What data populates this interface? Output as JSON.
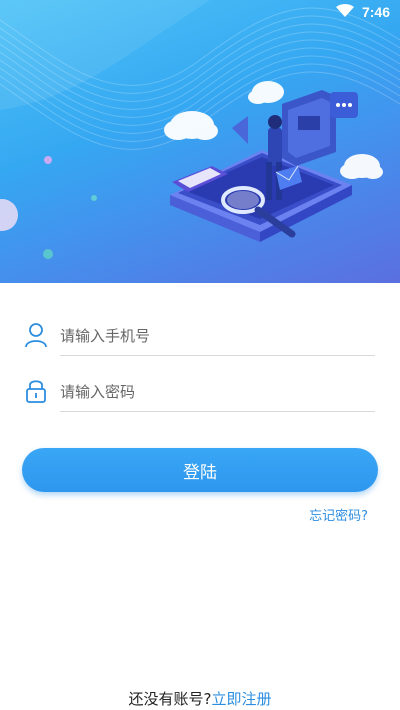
{
  "status_bar": {
    "time": "7:46",
    "wifi_icon": "wifi-icon"
  },
  "login_form": {
    "phone_placeholder": "请输入手机号",
    "phone_value": "",
    "password_placeholder": "请输入密码",
    "password_value": "",
    "login_label": "登陆",
    "forgot_label": "忘记密码?"
  },
  "register_prompt": {
    "text": "还没有账号?",
    "link": "立即注册"
  },
  "colors": {
    "accent": "#2d97ee",
    "link": "#2d8ee0",
    "hero_top": "#4fc3f7",
    "hero_bottom": "#5b6fe0"
  }
}
